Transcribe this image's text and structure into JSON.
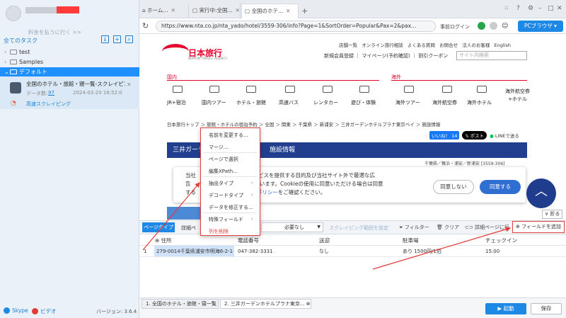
{
  "sidebar": {
    "upgrade_text": "料金を払うに行く >>",
    "all_tasks": "全てのタスク",
    "folders": [
      {
        "label": "test"
      },
      {
        "label": "Samples"
      },
      {
        "label": "デフォルト"
      }
    ],
    "task": {
      "title": "全国のホテル・旅館・寝一覧-スクレイピン...",
      "data_label": "データ数:",
      "data_count": "97",
      "date": "2024-03-20 16:52:0",
      "mode": "高速スクレイピング"
    },
    "skype": "Skype",
    "video": "ビデオ",
    "version": "バージョン: 3.6.4"
  },
  "browser": {
    "tabs": [
      {
        "label": "ホーム..."
      },
      {
        "label": "実行中:全国..."
      },
      {
        "label": "全国のホテ..."
      }
    ],
    "url": "https://www.nta.co.jp/nta_yado/hotel/3559-306/info?Page=1&SortOrder=Popular&Pax=2&pax...",
    "prelogin": "事前ログイン",
    "pc_browser": "PCブラウザ"
  },
  "webpage": {
    "logo": "日本旅行",
    "logo_sub": "NIPPON TRAVEL AGENCY",
    "header_links": [
      "店舗一覧",
      "オンライン旅行相談",
      "よくある質問",
      "お問合せ",
      "法人のお客様",
      "English"
    ],
    "header_links2": [
      "新規会員登録",
      "マイページ(予約確認)",
      "割引クーポン"
    ],
    "search_placeholder": "サイト内検索",
    "domestic": "国内",
    "international": "海外",
    "nav_domestic": [
      "JR+宿泊",
      "国内ツアー",
      "ホテル・旅館",
      "高速バス",
      "レンタカー",
      "遊び・体験"
    ],
    "nav_international": [
      "海外ツアー",
      "海外航空券",
      "海外ホテル",
      "海外航空券\n+ホテル"
    ],
    "breadcrumb": "日本旅行トップ ＞ 旅館・ホテルの宿泊予約 ＞ 全国 ＞ 関東 ＞ 千葉県 ＞ 新浦安 ＞ 三井ガーデンホテルプラナ東京ベイ ＞ 施設情報",
    "like": "いいね！ 14",
    "post": "ポスト",
    "line": "LINEで送る",
    "hotel_title": "三井ガーデ",
    "hotel_tab": "施設情報",
    "hotel_id": "千葉県／舞浜・浦安／新浦安 [3559-306]",
    "cookie_text_a": "当社",
    "cookie_text_1": "てとに最適なサービスを提供する目的及び当社サイト外で最適な広",
    "cookie_text_2": "告",
    "cookie_text_3": "くはを使用しています。Cookieの使用に同意いただける場合は同意",
    "cookie_text_b": "する",
    "cookie_text_4": "くは",
    "cookie_link": "プライバシーポリシー",
    "cookie_text_5": "をご確認ください。",
    "disagree": "同意しない",
    "agree": "同意する",
    "fold": "折る"
  },
  "context_menu": {
    "items": [
      {
        "label": "名前を変更する..."
      },
      {
        "label": "マージ..."
      },
      {
        "label": "ページで選択"
      },
      {
        "label": "編集XPath..."
      },
      {
        "label": "抽出タイプ"
      },
      {
        "label": "デコードタイプ"
      },
      {
        "label": "データを修正する..."
      },
      {
        "label": "特殊フィールド"
      },
      {
        "label": "列を削除"
      }
    ]
  },
  "data_panel": {
    "page_type": "ページタイプ",
    "detail": "詳細ペ",
    "not_needed": "必要なし",
    "scroll_range": "スクレイピング範囲を設定",
    "filter": "フィルター",
    "clear": "クリア",
    "detail_page": "詳細ページに行く",
    "add_field": "フィールドを追加",
    "columns": [
      "住所",
      "電話番号",
      "送迎",
      "駐車場",
      "チェックイン"
    ],
    "rows": [
      {
        "index": "1",
        "cells": [
          "279-0014千葉県浦安市明海6-2-1",
          "047-382-3331",
          "なし",
          "あり 1500円/1泊",
          "15:00"
        ]
      }
    ]
  },
  "bottom": {
    "tabs": [
      {
        "label": "1. 全国のホテル・旅館・寝一覧"
      },
      {
        "label": "2. 三井ガーデンホテルプラナ東京..."
      }
    ],
    "start": "起動",
    "save": "保存"
  }
}
